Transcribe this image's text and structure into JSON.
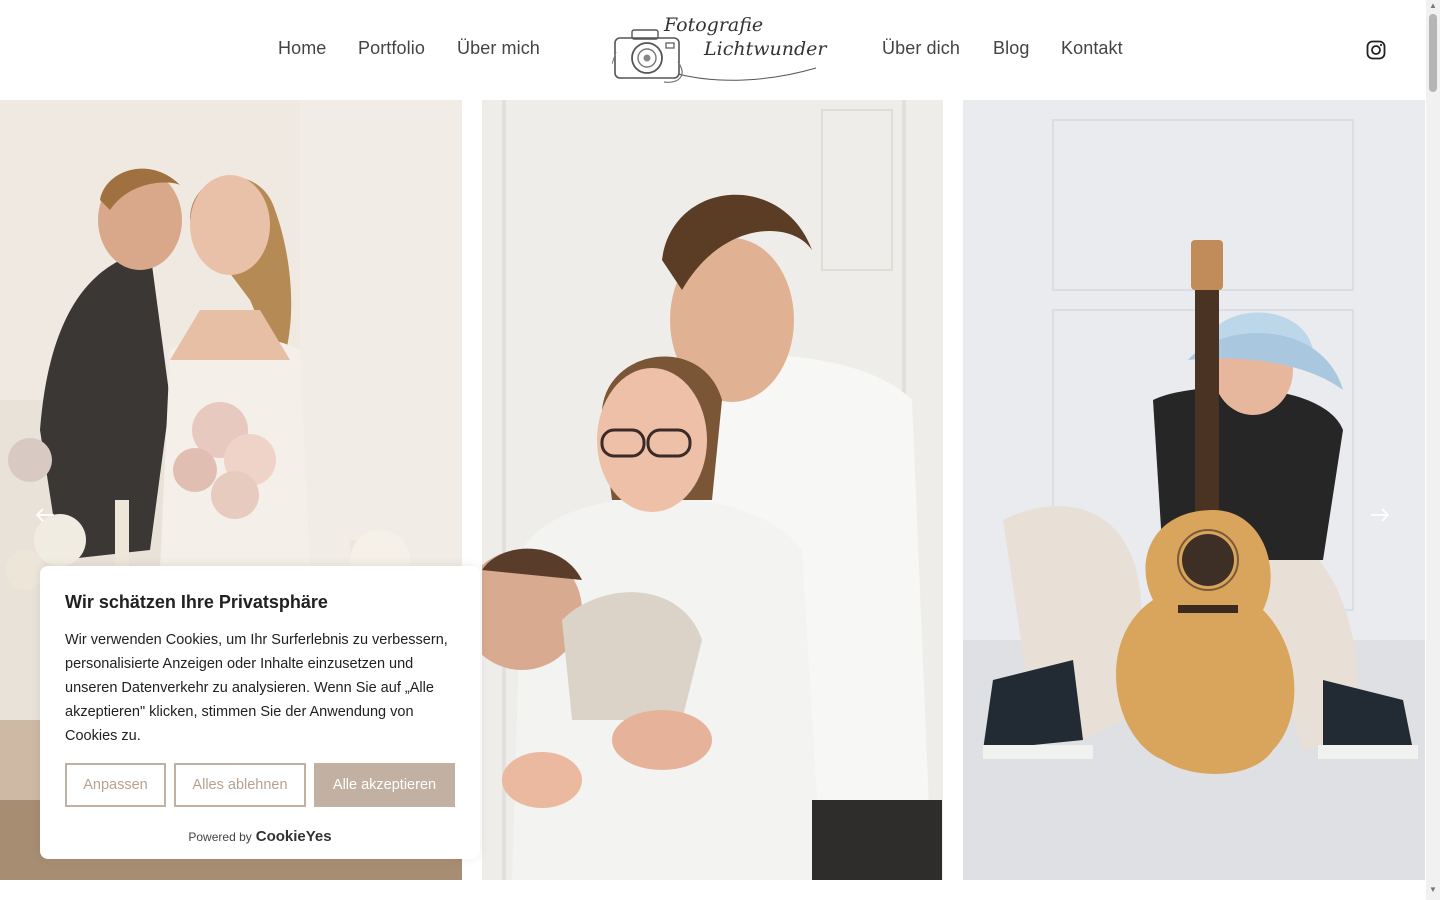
{
  "header": {
    "nav_left": [
      "Home",
      "Portfolio",
      "Über mich"
    ],
    "nav_right": [
      "Über dich",
      "Blog",
      "Kontakt"
    ],
    "logo": {
      "line1": "Fotografie",
      "line2": "Lichtwunder"
    },
    "social_icon": "instagram-icon"
  },
  "gallery": {
    "slides": [
      {
        "name": "wedding-couple-photo"
      },
      {
        "name": "family-newborn-photo"
      },
      {
        "name": "guitar-portrait-photo"
      }
    ],
    "prev_icon": "arrow-left-icon",
    "next_icon": "arrow-right-icon"
  },
  "cookie_banner": {
    "title": "Wir schätzen Ihre Privatsphäre",
    "text": "Wir verwenden Cookies, um Ihr Surferlebnis zu verbessern, personalisierte Anzeigen oder Inhalte einzusetzen und unseren Datenverkehr zu analysieren. Wenn Sie auf „Alle akzeptieren\" klicken, stimmen Sie der Anwendung von Cookies zu.",
    "buttons": {
      "customize": "Anpassen",
      "reject": "Alles ablehnen",
      "accept": "Alle akzeptieren"
    },
    "powered_by": "Powered by",
    "brand": "CookieYes"
  },
  "colors": {
    "accent": "#c2b1a2",
    "text": "#212121",
    "nav": "#444444"
  }
}
